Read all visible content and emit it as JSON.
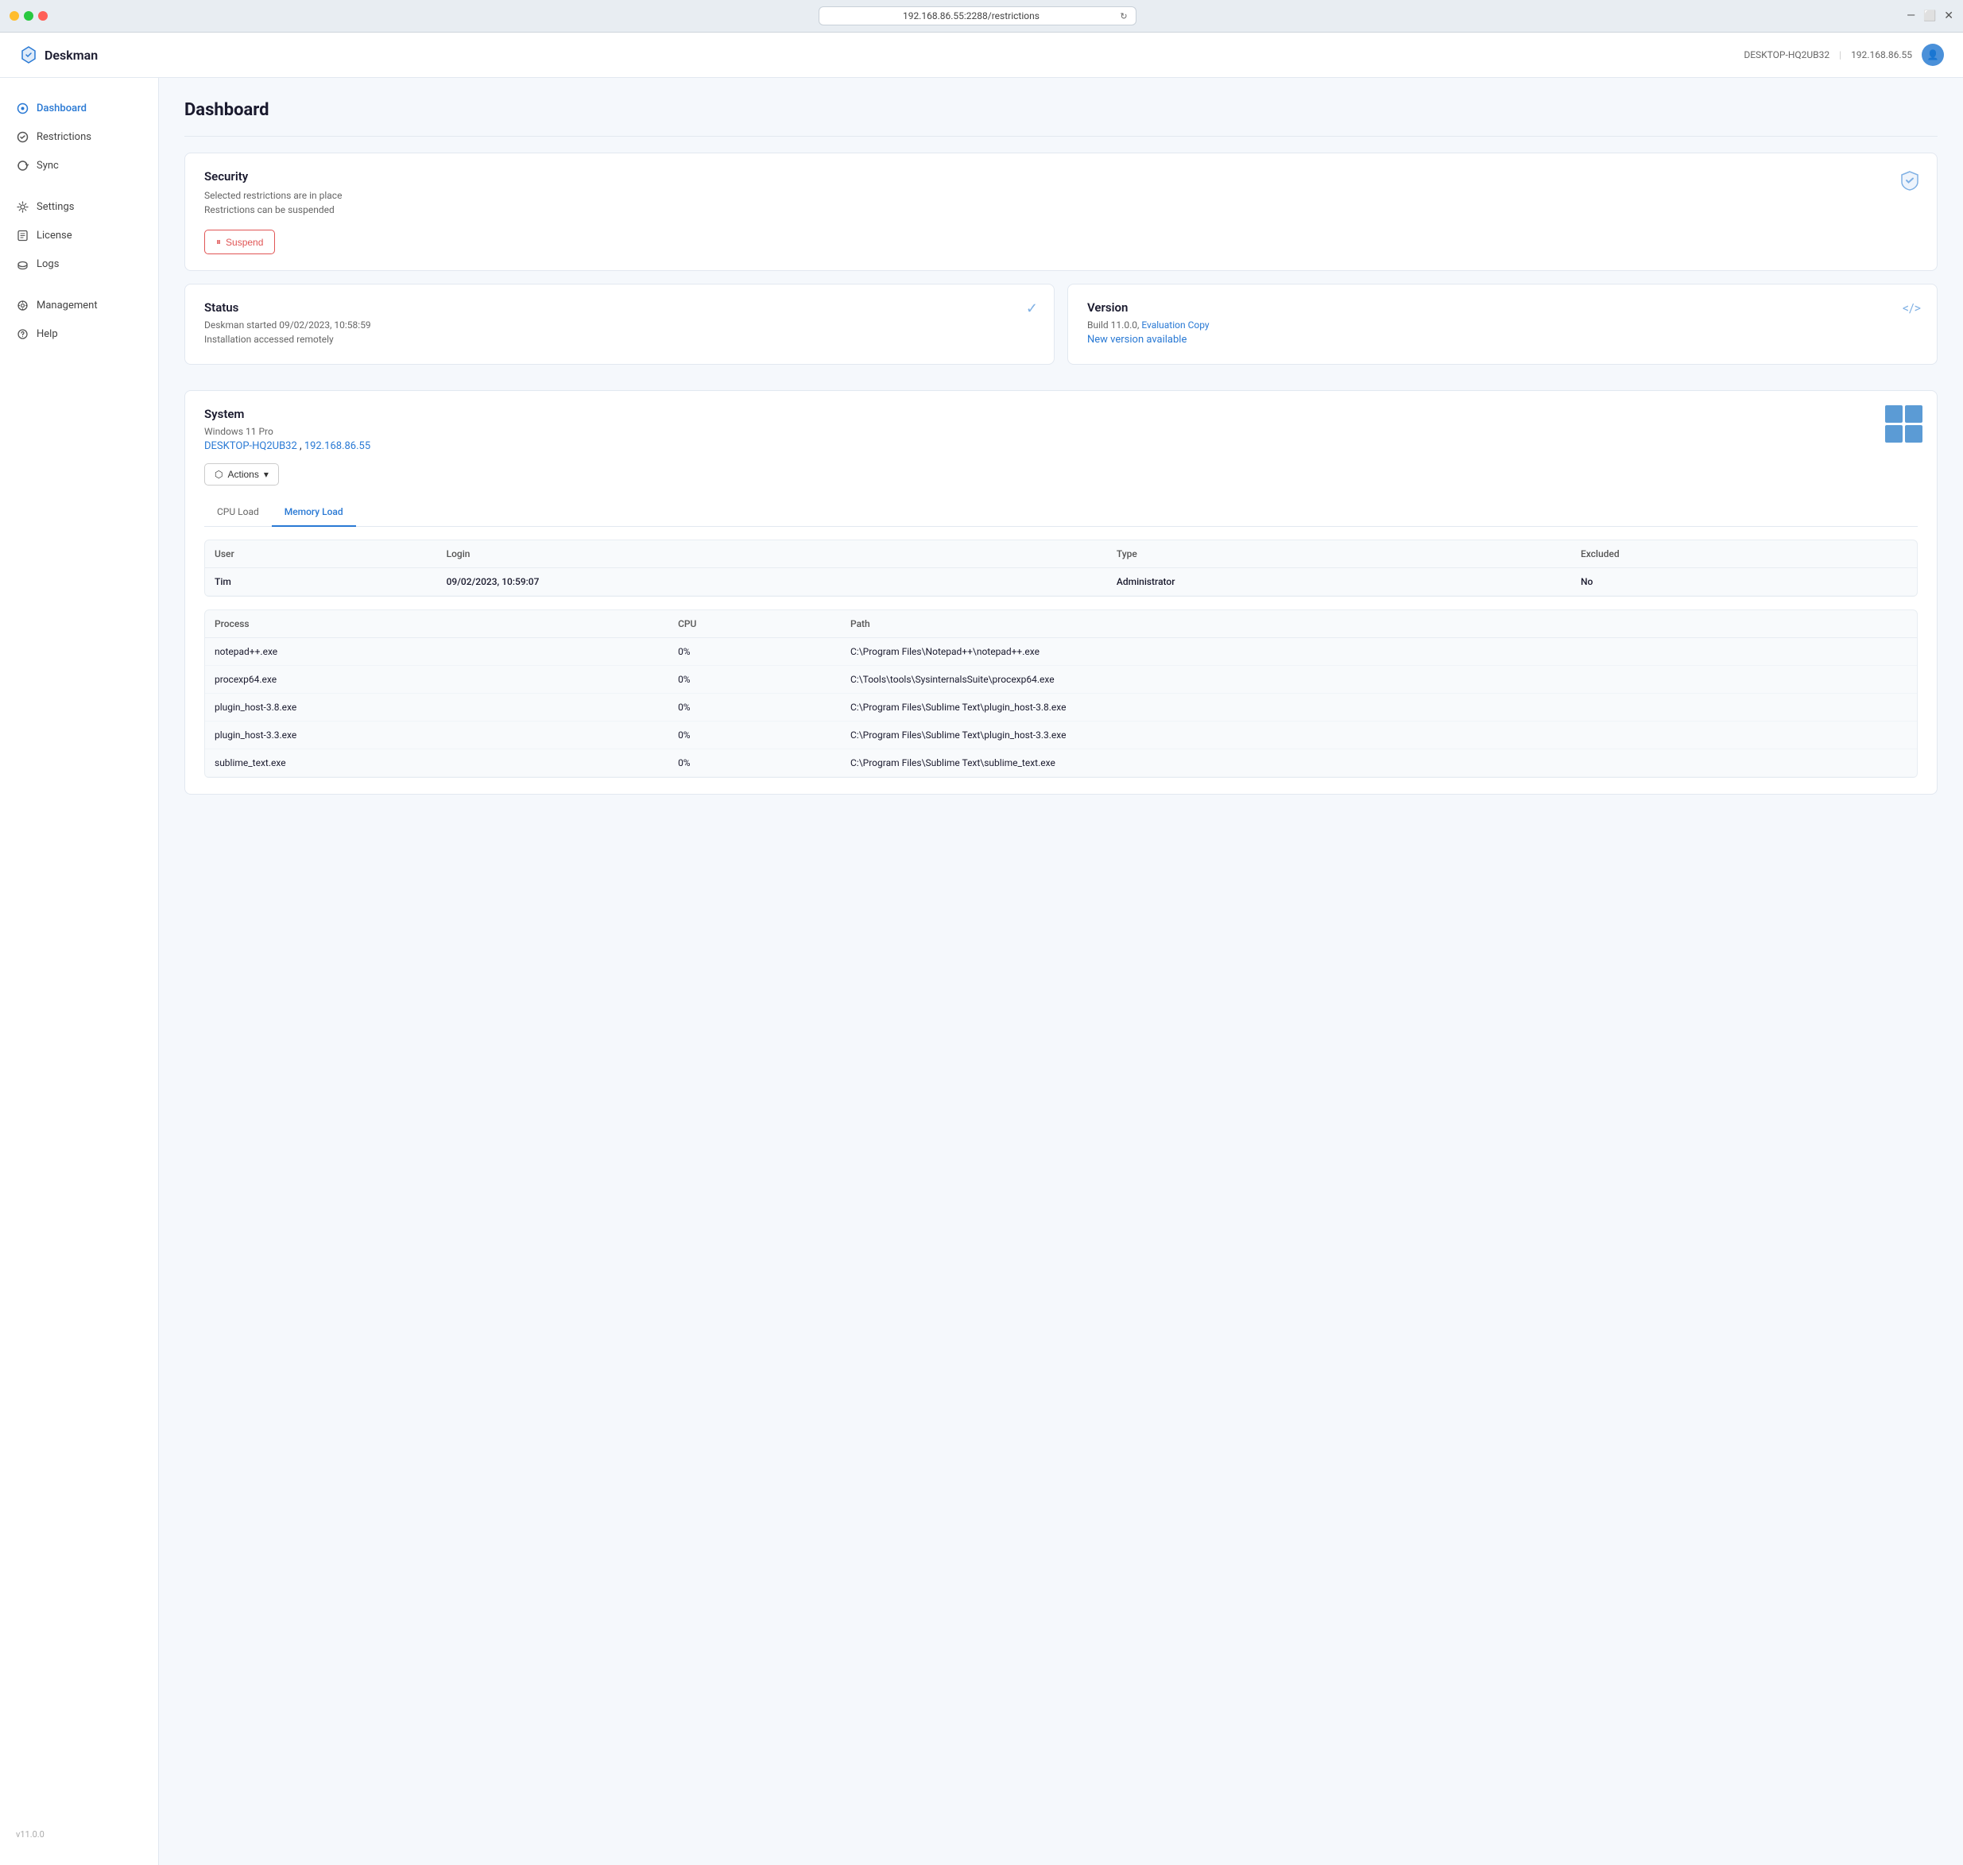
{
  "browser": {
    "address": "192.168.86.55:2288/restrictions",
    "reload_title": "Reload"
  },
  "app": {
    "logo_text": "Deskman",
    "header_machine": "DESKTOP-HQ2UB32",
    "header_separator": "|",
    "header_ip": "192.168.86.55",
    "avatar_initials": "U"
  },
  "sidebar": {
    "items": [
      {
        "id": "dashboard",
        "label": "Dashboard",
        "active": true
      },
      {
        "id": "restrictions",
        "label": "Restrictions",
        "active": false
      },
      {
        "id": "sync",
        "label": "Sync",
        "active": false
      },
      {
        "id": "settings",
        "label": "Settings",
        "active": false
      },
      {
        "id": "license",
        "label": "License",
        "active": false
      },
      {
        "id": "logs",
        "label": "Logs",
        "active": false
      },
      {
        "id": "management",
        "label": "Management",
        "active": false
      },
      {
        "id": "help",
        "label": "Help",
        "active": false
      }
    ],
    "version": "v11.0.0"
  },
  "main": {
    "page_title": "Dashboard",
    "security": {
      "title": "Security",
      "subtitle1": "Selected restrictions are in place",
      "subtitle2": "Restrictions can be suspended",
      "suspend_label": "Suspend"
    },
    "status": {
      "title": "Status",
      "line1": "Deskman started 09/02/2023, 10:58:59",
      "line2": "Installation accessed remotely"
    },
    "version": {
      "title": "Version",
      "build": "Build 11.0.0,",
      "eval_link": "Evaluation Copy",
      "new_version_link": "New version available"
    },
    "system": {
      "title": "System",
      "os": "Windows 11 Pro",
      "machine_link": "DESKTOP-HQ2UB32",
      "ip_link": "192.168.86.55",
      "actions_label": "Actions"
    },
    "tabs": [
      {
        "id": "cpu",
        "label": "CPU Load",
        "active": false
      },
      {
        "id": "memory",
        "label": "Memory Load",
        "active": true
      }
    ],
    "users_table": {
      "columns": [
        "User",
        "Login",
        "Type",
        "Excluded"
      ],
      "rows": [
        {
          "user": "Tim",
          "login": "09/02/2023, 10:59:07",
          "type": "Administrator",
          "excluded": "No"
        }
      ]
    },
    "processes_table": {
      "columns": [
        "Process",
        "CPU",
        "Path"
      ],
      "rows": [
        {
          "process": "notepad++.exe",
          "cpu": "0%",
          "path": "C:\\Program Files\\Notepad++\\notepad++.exe"
        },
        {
          "process": "procexp64.exe",
          "cpu": "0%",
          "path": "C:\\Tools\\tools\\SysinternalsSuite\\procexp64.exe"
        },
        {
          "process": "plugin_host-3.8.exe",
          "cpu": "0%",
          "path": "C:\\Program Files\\Sublime Text\\plugin_host-3.8.exe"
        },
        {
          "process": "plugin_host-3.3.exe",
          "cpu": "0%",
          "path": "C:\\Program Files\\Sublime Text\\plugin_host-3.3.exe"
        },
        {
          "process": "sublime_text.exe",
          "cpu": "0%",
          "path": "C:\\Program Files\\Sublime Text\\sublime_text.exe"
        }
      ]
    }
  }
}
